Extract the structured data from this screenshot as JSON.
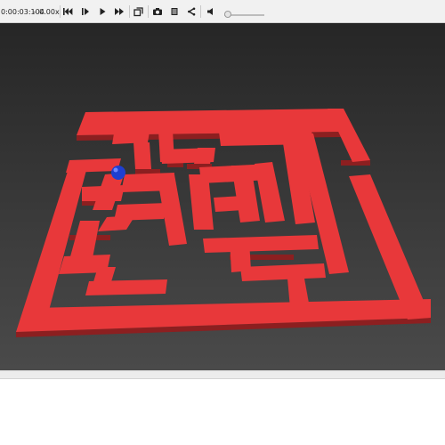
{
  "toolbar": {
    "time_readout": "0:00:03:104",
    "speed_decrease": "-",
    "speed_readout": "0.00x",
    "icons": [
      "skip-to-start-icon",
      "step-forward-icon",
      "play-icon",
      "fast-forward-icon",
      "camera-view-icon",
      "screenshot-camera-icon",
      "record-icon",
      "share-icon",
      "volume-icon"
    ],
    "volume_level": 0.0
  },
  "scene": {
    "background_top": "#262626",
    "background_bottom": "#4a4a4a",
    "maze_color": "#e8383a",
    "maze_side_color": "#8c1f20",
    "ball_color": "#1f3fd0"
  }
}
